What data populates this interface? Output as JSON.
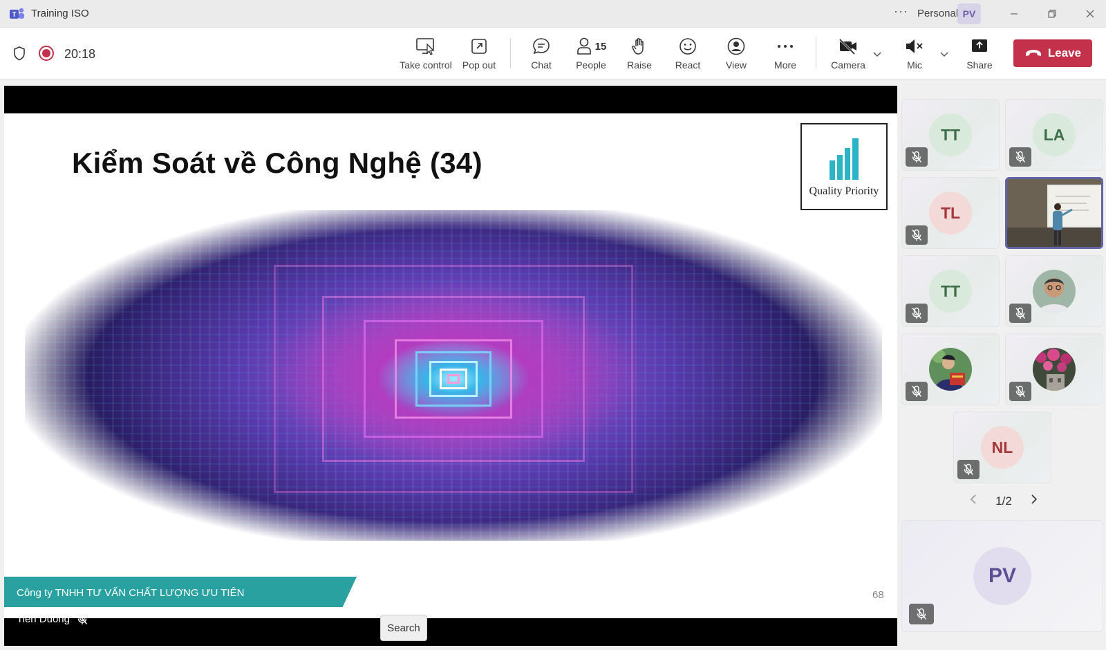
{
  "window": {
    "title": "Training ISO",
    "more_icon": "ellipsis-icon",
    "account_label": "Personal",
    "account_initials": "PV"
  },
  "toolbar": {
    "timer": "20:18",
    "take_control_label": "Take control",
    "pop_out_label": "Pop out",
    "chat_label": "Chat",
    "people_label": "People",
    "people_count": "15",
    "raise_label": "Raise",
    "react_label": "React",
    "view_label": "View",
    "more_label": "More",
    "camera_label": "Camera",
    "mic_label": "Mic",
    "share_label": "Share",
    "leave_label": "Leave"
  },
  "slide": {
    "title": "Kiểm Soát về Công Nghệ (34)",
    "logo_text": "Quality Priority",
    "footer_company": "Công ty TNHH TƯ VẤN CHẤT LƯỢNG ƯU TIÊN",
    "page_number": "68"
  },
  "presenter": {
    "name": "Tien Duong",
    "muted": true
  },
  "search_tooltip": "Search",
  "gallery": {
    "participants": [
      {
        "initials": "TT",
        "color": "green",
        "muted": true
      },
      {
        "initials": "LA",
        "color": "green",
        "muted": true
      },
      {
        "initials": "TL",
        "color": "red",
        "muted": true
      },
      {
        "initials": "",
        "type": "video",
        "muted": false
      },
      {
        "initials": "TT",
        "color": "green",
        "muted": true
      },
      {
        "initials": "",
        "type": "photo",
        "muted": true
      },
      {
        "initials": "",
        "type": "photo",
        "muted": true
      },
      {
        "initials": "",
        "type": "photo",
        "muted": true
      },
      {
        "initials": "NL",
        "color": "red",
        "muted": true
      }
    ],
    "page_indicator": "1/2",
    "self_initials": "PV"
  },
  "colors": {
    "leave": "#c4314b",
    "accent": "#6264a7",
    "slide_band": "#2aa1a1"
  }
}
